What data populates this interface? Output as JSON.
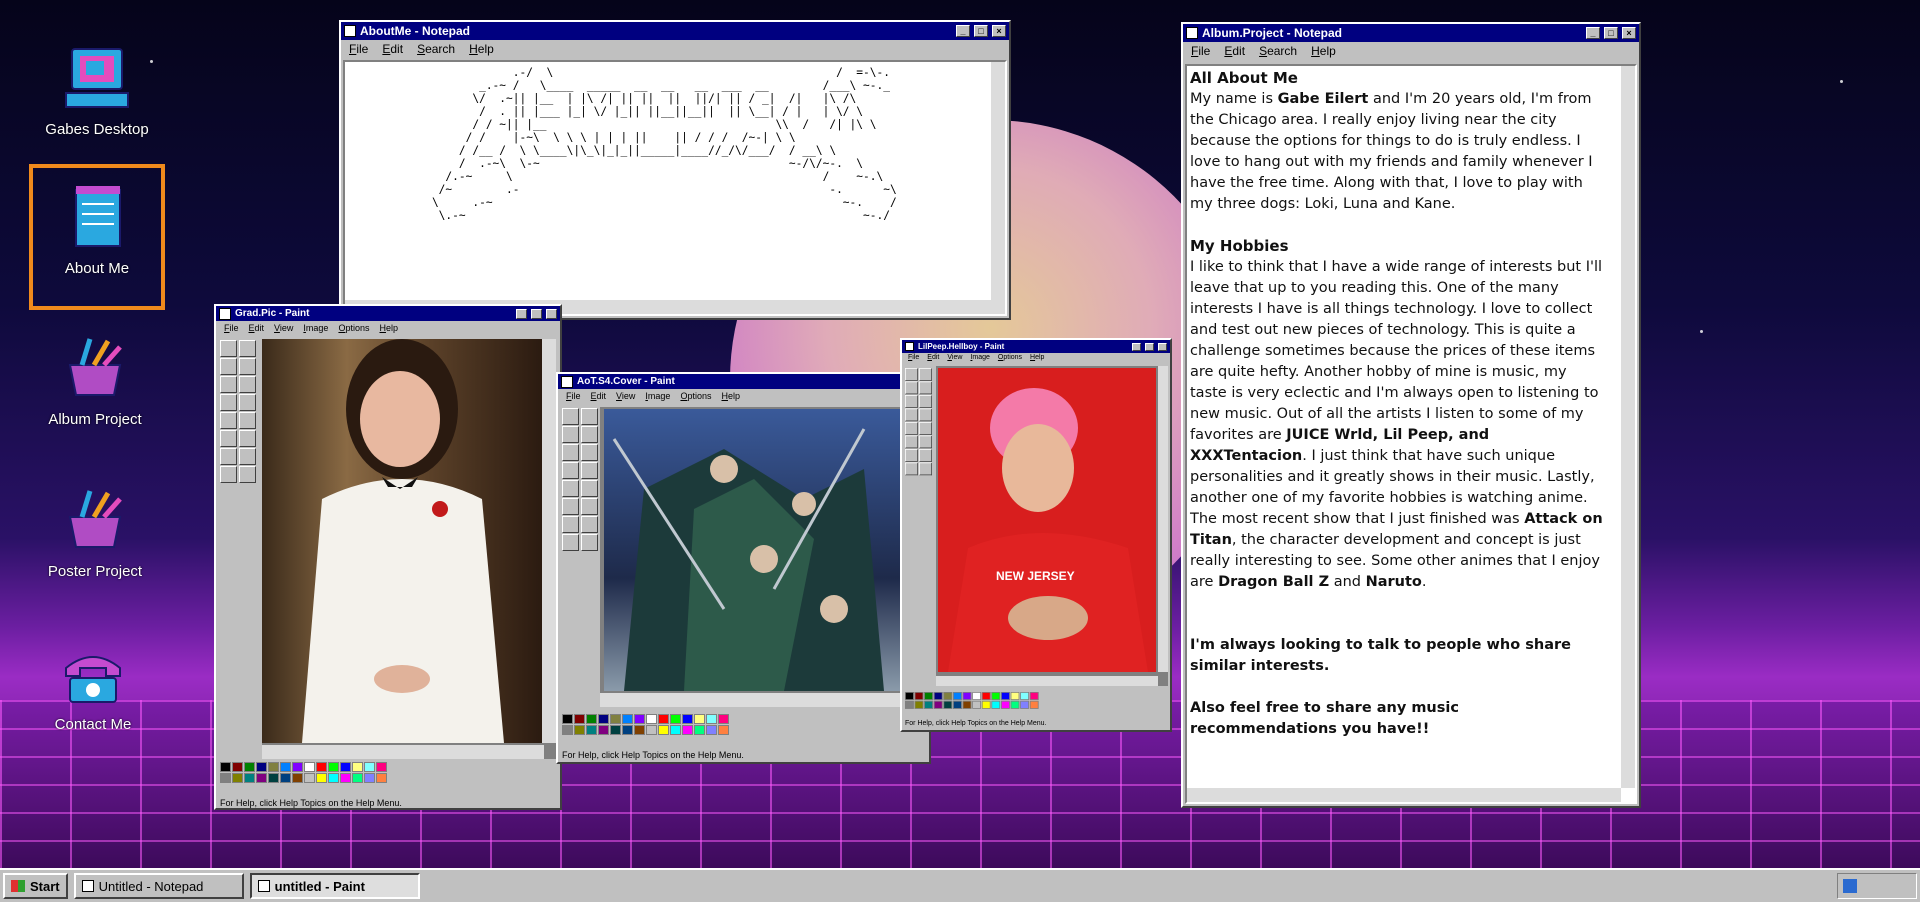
{
  "desktop": {
    "icons": [
      {
        "label": "Gabes Desktop",
        "icon": "computer-icon"
      },
      {
        "label": "About Me",
        "icon": "notepad-icon"
      },
      {
        "label": "Album Project",
        "icon": "paint-icon"
      },
      {
        "label": "Poster Project",
        "icon": "paint-icon"
      },
      {
        "label": "Contact Me",
        "icon": "phone-icon"
      }
    ]
  },
  "about_window": {
    "title": "AboutMe - Notepad",
    "menu": [
      "File",
      "Edit",
      "Search",
      "Help"
    ],
    "ascii_art": "                .-/  \\                                          /  =-\\-.\n           _.-~ /   \\____  _____  __  __   __  ___  __        /___\\ ~-._\n          \\/  .~|| |__  | |\\ /| || ||  ||  ||/| || / _|  /|   |\\ /\\\n           /  . || |___ |_| \\/ |_|| ||__||__||  || \\__| / |   | \\/ \\\n          / / ~|| |__                                  \\\\  /   /| |\\ \\\n         / /    |-~\\  \\ \\ \\ | | | ||    || / / /  /~-| \\ \\\n        / /__ /  \\ \\____\\|\\_\\|_|_||_____|____//_/\\/___/  / __\\ \\\n        /  .-~\\  \\-~                                     ~-/\\/~-.  \\\n      /.-~     \\                                              /    ~-.\\\n     /~        .-                                              -.      ~\\\n    \\     .-~                                                    ~-.    /\n     \\.-~                                                           ~-./"
  },
  "grad_window": {
    "title": "Grad.Pic - Paint",
    "menu": [
      "File",
      "Edit",
      "View",
      "Image",
      "Options",
      "Help"
    ],
    "status": "For Help, click Help Topics on the Help Menu."
  },
  "aot_window": {
    "title": "AoT.S4.Cover - Paint",
    "menu": [
      "File",
      "Edit",
      "View",
      "Image",
      "Options",
      "Help"
    ],
    "status": "For Help, click Help Topics on the Help Menu."
  },
  "lilpeep_window": {
    "title": "LilPeep.Hellboy - Paint",
    "menu": [
      "File",
      "Edit",
      "View",
      "Image",
      "Options",
      "Help"
    ],
    "status": "For Help, click Help Topics on the Help Menu.",
    "shirt_text": "NEW JERSEY"
  },
  "album_window": {
    "title": "Album.Project - Notepad",
    "menu": [
      "File",
      "Edit",
      "Search",
      "Help"
    ],
    "heading1": "All About Me",
    "p1_a": "My name is ",
    "p1_name": "Gabe Eilert",
    "p1_b": " and I'm 20 years old, I'm from the Chicago area. I really enjoy living near the city because the options for things to do is truly endless. I love to hang out with my friends and family whenever I have the free time. Along with that, I love to play with my three dogs: Loki, Luna and Kane.",
    "heading2": "My Hobbies",
    "p2_a": "I like to think that I have a wide range of interests but I'll leave that up to you reading this. One of the many interests I have is all things technology. I love to collect and test out new pieces of technology. This is quite a challenge sometimes because the prices of these items are quite hefty. Another hobby of mine is music, my taste is very eclectic and I'm always open to listening to new music. Out of all the artists I listen to some of my favorites are ",
    "p2_artists": "JUICE Wrld, Lil Peep, and XXXTentacion",
    "p2_b": ". I just think that have such unique personalities and it greatly shows in their music. Lastly, another one of my favorite hobbies is watching anime. The most recent show that I just finished was ",
    "p2_show": "Attack on Titan",
    "p2_c": ", the character development and concept is just really interesting to see. Some other animes that I enjoy are ",
    "p2_dbz": "Dragon Ball Z",
    "p2_d": " and ",
    "p2_naruto": "Naruto",
    "p2_e": ".",
    "p3": "I'm always looking to talk to people who share similar interests.",
    "p4": "Also feel free to share any music recommendations you have!!"
  },
  "taskbar": {
    "start": "Start",
    "items": [
      "Untitled - Notepad",
      "untitled - Paint"
    ],
    "active_index": 1
  },
  "colors": {
    "title_bar": "#000080",
    "window_face": "#c0c0c0",
    "selection_outline": "#f08a1c"
  },
  "palette_colors": [
    "#000000",
    "#808080",
    "#800000",
    "#808000",
    "#008000",
    "#008080",
    "#000080",
    "#800080",
    "#808040",
    "#004040",
    "#0080ff",
    "#004080",
    "#8000ff",
    "#804000",
    "#ffffff",
    "#c0c0c0",
    "#ff0000",
    "#ffff00",
    "#00ff00",
    "#00ffff",
    "#0000ff",
    "#ff00ff",
    "#ffff80",
    "#00ff80",
    "#80ffff",
    "#8080ff",
    "#ff0080",
    "#ff8040"
  ]
}
